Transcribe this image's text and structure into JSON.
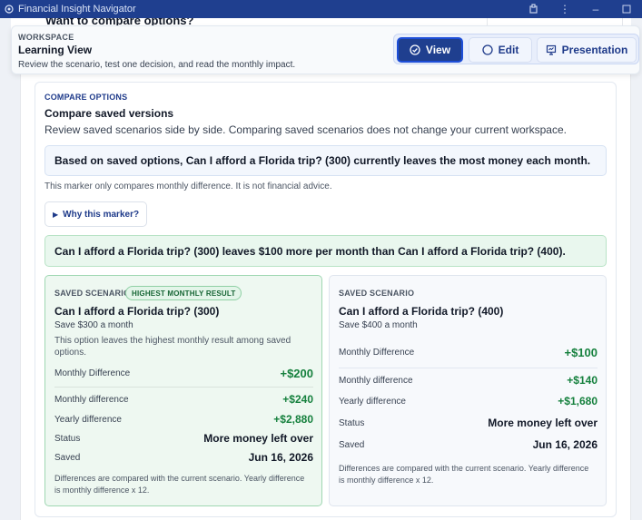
{
  "window": {
    "title": "Financial Insight Navigator"
  },
  "background_peek": {
    "text": "Want to compare options?"
  },
  "header": {
    "eyebrow": "WORKSPACE",
    "title": "Learning View",
    "description": "Review the scenario, test one decision, and read the monthly impact.",
    "modes": [
      {
        "label": "View",
        "icon": "check-circle-icon",
        "active": true
      },
      {
        "label": "Edit",
        "icon": "circle-icon",
        "active": false
      },
      {
        "label": "Presentation",
        "icon": "presentation-icon",
        "active": false
      }
    ]
  },
  "compare": {
    "eyebrow": "COMPARE OPTIONS",
    "title": "Compare saved versions",
    "description": "Review saved scenarios side by side. Comparing saved scenarios does not change your current workspace.",
    "marker_text": "Based on saved options, Can I afford a Florida trip? (300) currently leaves the most money each month.",
    "marker_note": "This marker only compares monthly difference. It is not financial advice.",
    "why_label": "Why this marker?",
    "difference_text": "Can I afford a Florida trip? (300) leaves $100 more per month than Can I afford a Florida trip? (400)."
  },
  "cards": [
    {
      "eyebrow": "SAVED SCENARIO",
      "badge": "HIGHEST MONTHLY RESULT",
      "title": "Can I afford a Florida trip? (300)",
      "subtitle": "Save $300 a month",
      "description": "This option leaves the highest monthly result among saved options.",
      "headline_label": "Monthly Difference",
      "headline_value": "+$200",
      "rows": [
        {
          "label": "Monthly difference",
          "value": "+$240"
        },
        {
          "label": "Yearly difference",
          "value": "+$2,880"
        },
        {
          "label": "Status",
          "value": "More money left over"
        },
        {
          "label": "Saved",
          "value": "Jun 16, 2026"
        }
      ],
      "footnote": "Differences are compared with the current scenario. Yearly difference is monthly difference x 12."
    },
    {
      "eyebrow": "SAVED SCENARIO",
      "title": "Can I afford a Florida trip? (400)",
      "subtitle": "Save $400 a month",
      "headline_label": "Monthly Difference",
      "headline_value": "+$100",
      "rows": [
        {
          "label": "Monthly difference",
          "value": "+$140"
        },
        {
          "label": "Yearly difference",
          "value": "+$1,680"
        },
        {
          "label": "Status",
          "value": "More money left over"
        },
        {
          "label": "Saved",
          "value": "Jun 16, 2026"
        }
      ],
      "footnote": "Differences are compared with the current scenario. Yearly difference is monthly difference x 12."
    }
  ],
  "colors": {
    "titlebar": "#1f3f8f",
    "accent": "#1e3a8a",
    "positive": "#15803d",
    "best_card_bg": "#eef8f1"
  }
}
